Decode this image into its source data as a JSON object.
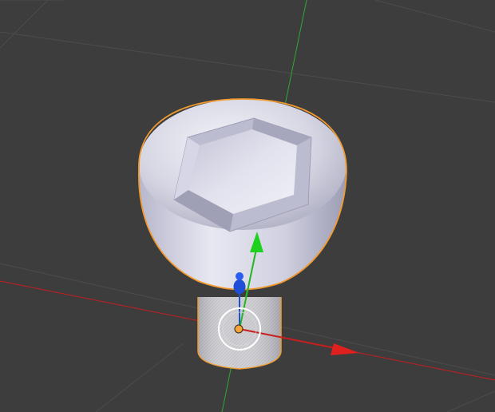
{
  "viewport": {
    "kind": "3d-viewport",
    "background": "#3d3d3d",
    "grid_color": "#4a4a4a"
  },
  "axes": {
    "x_color": "#c81e1e",
    "y_color": "#2fa92f",
    "z_color": "#1f4fd6"
  },
  "object": {
    "kind": "socket-head-screw",
    "selected": true,
    "outline_color": "#f29a2e",
    "body_color": "#c9c9d6"
  },
  "gizmo": {
    "origin_color": "#f2a33a",
    "ring_color": "#ffffff",
    "transform_arrows": [
      "x-arrow",
      "y-arrow",
      "z-arrow"
    ]
  }
}
